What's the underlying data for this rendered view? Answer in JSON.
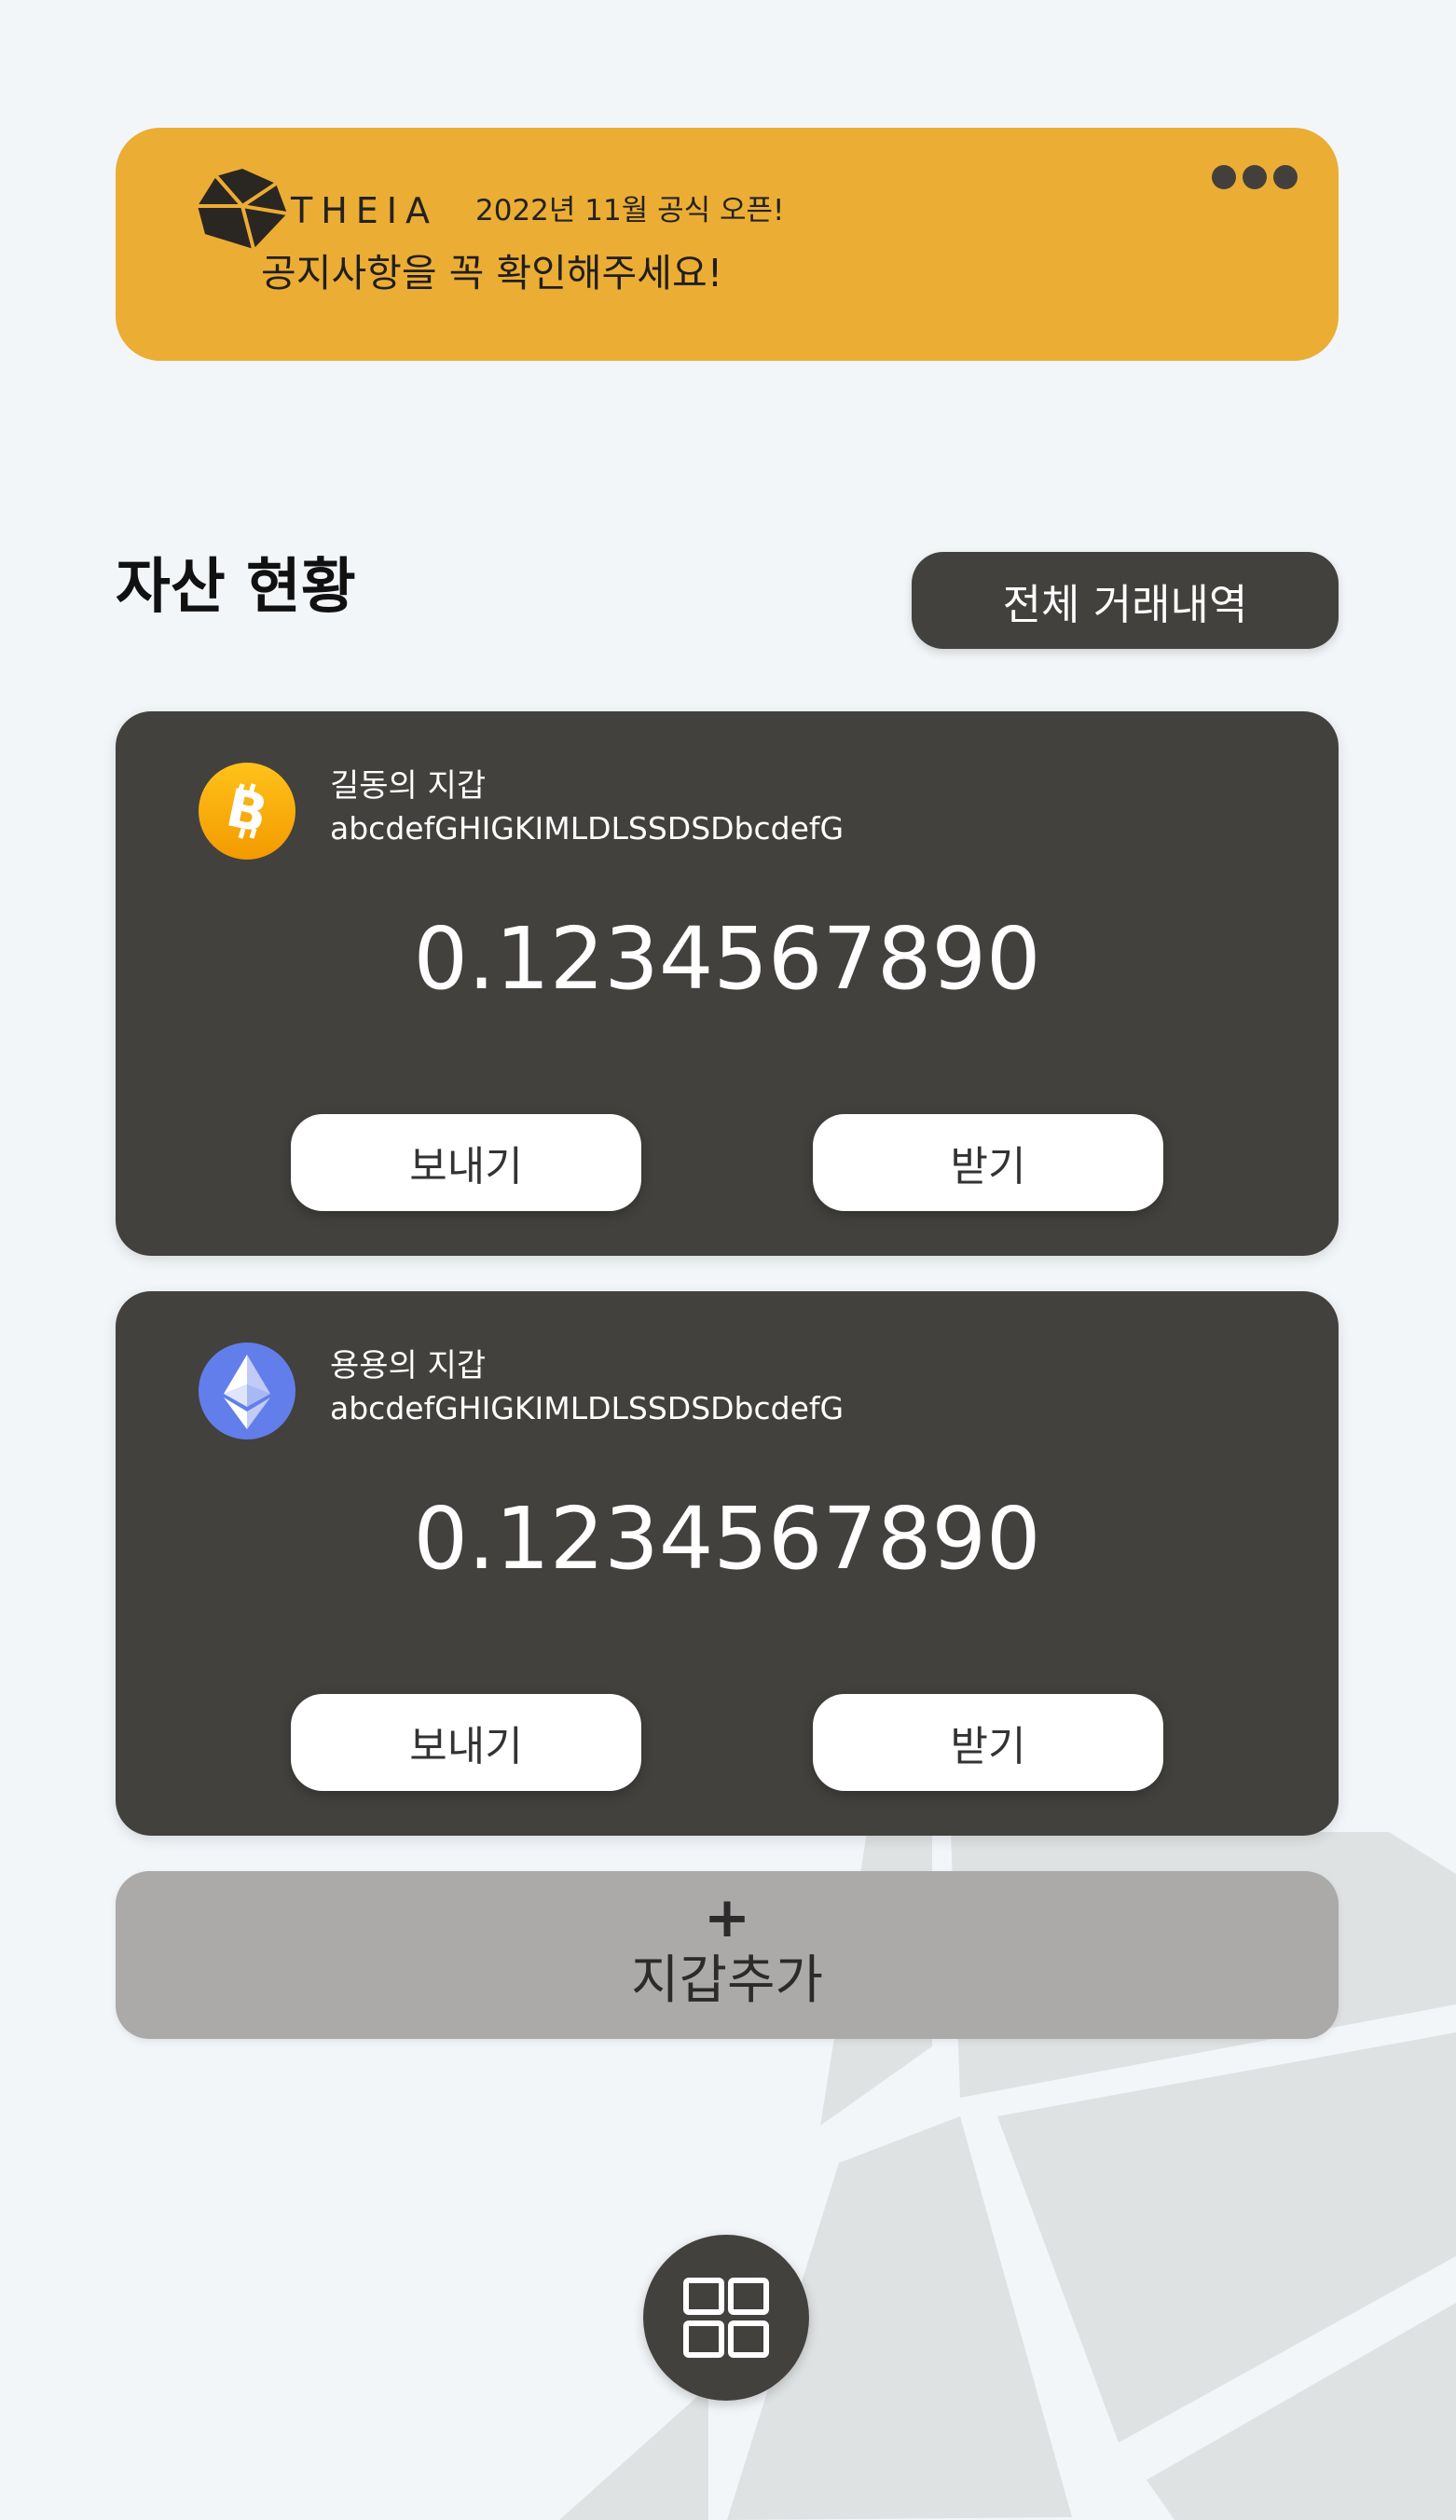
{
  "notice": {
    "brand": "THEIA",
    "open_text": "2022년 11월 공식 오픈!",
    "message": "공지사항을 꼭 확인해주세요!",
    "more_icon": "more-horizontal-icon"
  },
  "assets": {
    "title": "자산 현황",
    "history_button": "전체 거래내역"
  },
  "wallets": [
    {
      "coin_icon": "bitcoin-icon",
      "name": "길동의 지갑",
      "address": "abcdefGHIGKIMLDLSSDSDbcdefG",
      "balance": "0.1234567890",
      "send_label": "보내기",
      "receive_label": "받기"
    },
    {
      "coin_icon": "ethereum-icon",
      "name": "용용의 지갑",
      "address": "abcdefGHIGKIMLDLSSDSDbcdefG",
      "balance": "0.1234567890",
      "send_label": "보내기",
      "receive_label": "받기"
    }
  ],
  "add_wallet": {
    "plus": "+",
    "label": "지갑추가"
  },
  "bottom": {
    "menu_icon": "grid-menu-icon"
  },
  "colors": {
    "notice_bg": "#ecad34",
    "card_bg": "#43413e",
    "page_bg": "#f2f6f9",
    "add_wallet_bg": "#abaaa8",
    "bitcoin": "#f7a600",
    "ethereum": "#627eea"
  }
}
